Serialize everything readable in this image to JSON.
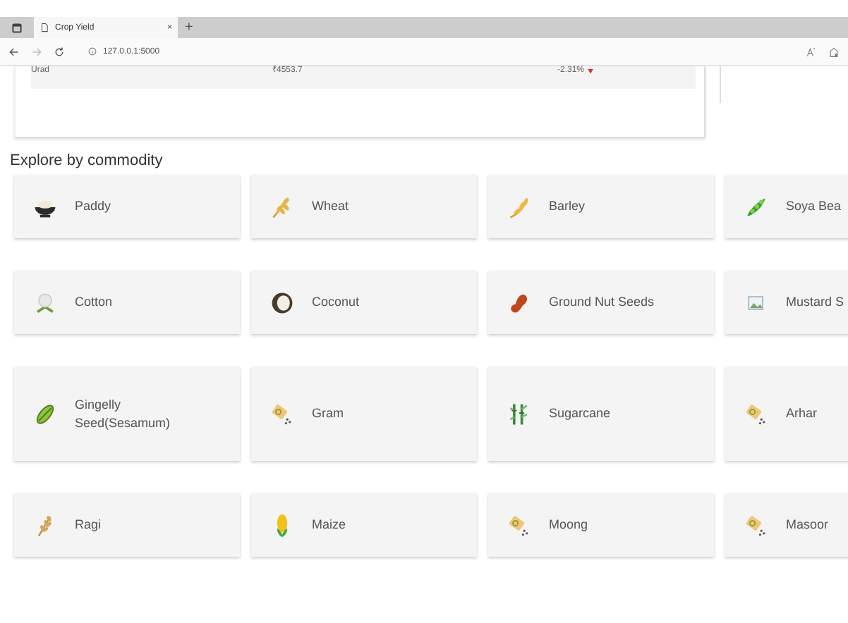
{
  "browser": {
    "tab_title": "Crop Yield",
    "tab_close": "×",
    "new_tab": "+",
    "address": "127.0.0.1:5000"
  },
  "price_table": {
    "rows": [
      {
        "commodity": "Urad",
        "price": "₹4553.7",
        "change": "-2.31%",
        "falling": true
      }
    ]
  },
  "section_title": "Explore by commodity",
  "commodities": [
    {
      "label": "Paddy"
    },
    {
      "label": "Wheat"
    },
    {
      "label": "Barley"
    },
    {
      "label": "Soya Bea"
    },
    {
      "label": "Cotton"
    },
    {
      "label": "Coconut"
    },
    {
      "label": "Ground Nut Seeds"
    },
    {
      "label": "Mustard S"
    },
    {
      "label": "Gingelly Seed(Sesamum)"
    },
    {
      "label": "Gram"
    },
    {
      "label": "Sugarcane"
    },
    {
      "label": "Arhar"
    },
    {
      "label": "Ragi"
    },
    {
      "label": "Maize"
    },
    {
      "label": "Moong"
    },
    {
      "label": "Masoor"
    }
  ]
}
